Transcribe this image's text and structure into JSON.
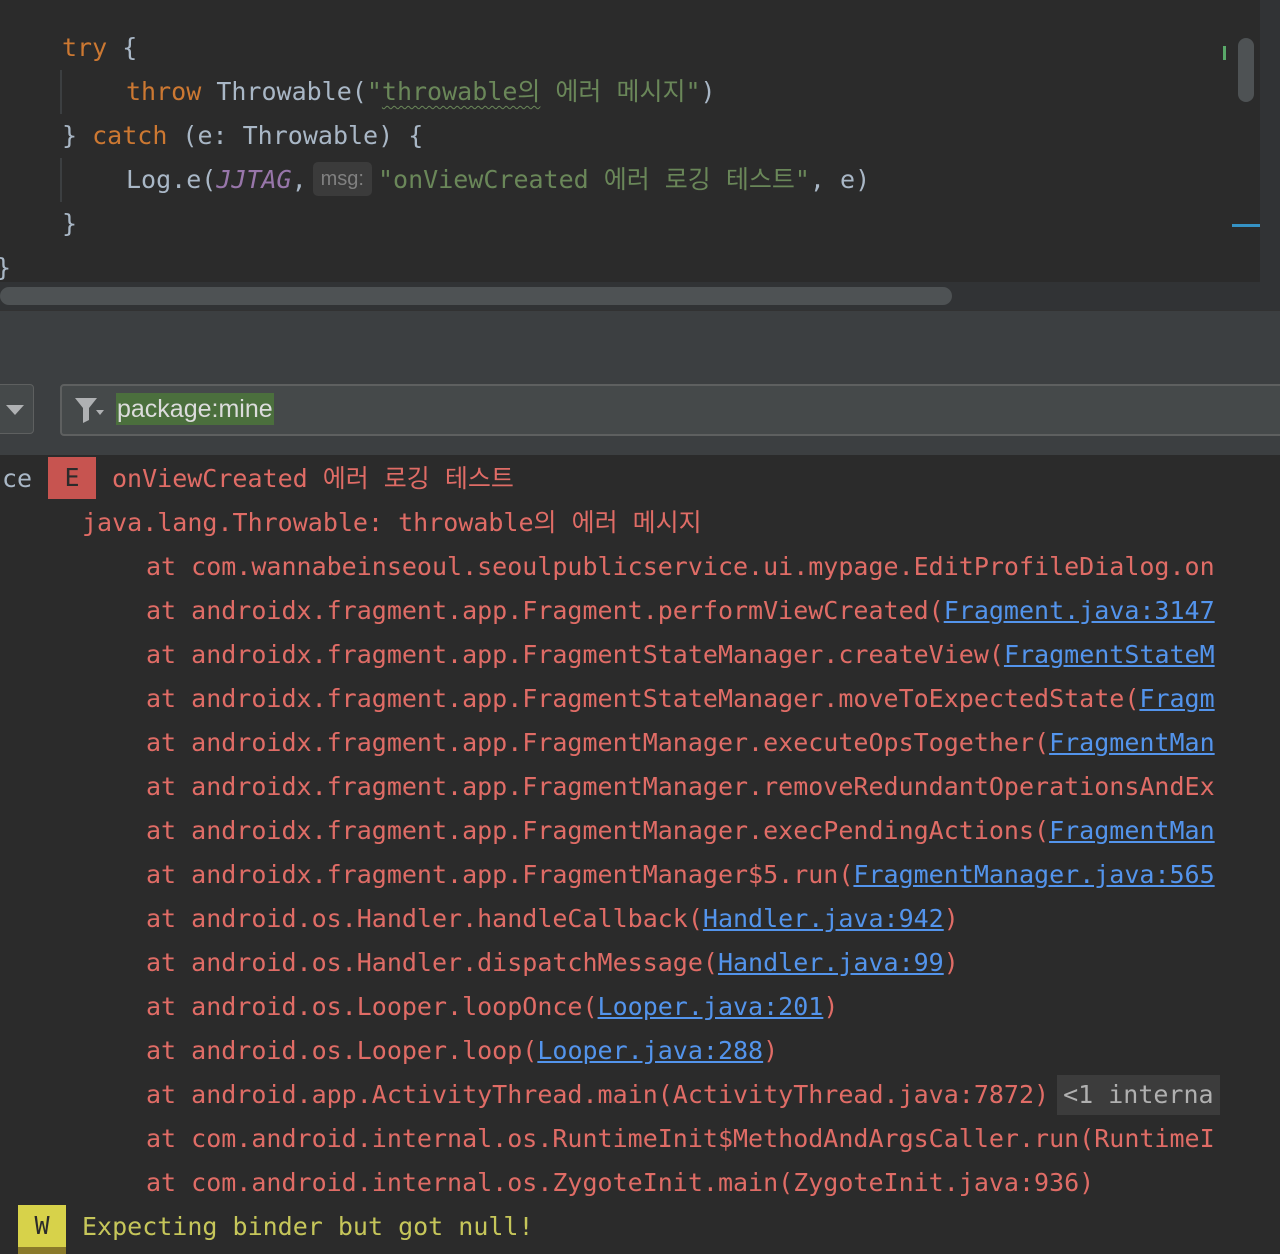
{
  "editor": {
    "lines": {
      "try_kw": "try",
      "try_brace": " {",
      "throw_kw": "throw",
      "throw_call": " Throwable(",
      "throw_quote_open": "\"",
      "throw_squiggly": "throwable의",
      "throw_msg_rest": " 에러 메시지\"",
      "throw_close": ")",
      "catch_open": "} ",
      "catch_kw": "catch",
      "catch_rest": " (e: Throwable) {",
      "log_call": "Log.e(",
      "log_tag": "JJTAG",
      "log_comma": ",",
      "param_hint": "msg:",
      "log_msg": "\"onViewCreated 에러 로깅 테스트\"",
      "log_rest": ", e)",
      "inner_close": "}",
      "outer_close": "}"
    }
  },
  "logcat": {
    "filter": {
      "query": "package:mine"
    },
    "entries": {
      "error": {
        "tag_fragment": "ce",
        "level": "E",
        "message": "onViewCreated 에러 로깅 테스트",
        "exception": "java.lang.Throwable: throwable의 에러 메시지",
        "stack": [
          {
            "text": "at com.wannabeinseoul.seoulpublicservice.ui.mypage.EditProfileDialog.on",
            "link": "",
            "tail": ""
          },
          {
            "text": "at androidx.fragment.app.Fragment.performViewCreated(",
            "link": "Fragment.java:3147",
            "tail": ""
          },
          {
            "text": "at androidx.fragment.app.FragmentStateManager.createView(",
            "link": "FragmentStateM",
            "tail": ""
          },
          {
            "text": "at androidx.fragment.app.FragmentStateManager.moveToExpectedState(",
            "link": "Fragm",
            "tail": ""
          },
          {
            "text": "at androidx.fragment.app.FragmentManager.executeOpsTogether(",
            "link": "FragmentMan",
            "tail": ""
          },
          {
            "text": "at androidx.fragment.app.FragmentManager.removeRedundantOperationsAndEx",
            "link": "",
            "tail": ""
          },
          {
            "text": "at androidx.fragment.app.FragmentManager.execPendingActions(",
            "link": "FragmentMan",
            "tail": ""
          },
          {
            "text": "at androidx.fragment.app.FragmentManager$5.run(",
            "link": "FragmentManager.java:565",
            "tail": ""
          },
          {
            "text": "at android.os.Handler.handleCallback(",
            "link": "Handler.java:942",
            "tail": ")"
          },
          {
            "text": "at android.os.Handler.dispatchMessage(",
            "link": "Handler.java:99",
            "tail": ")"
          },
          {
            "text": "at android.os.Looper.loopOnce(",
            "link": "Looper.java:201",
            "tail": ")"
          },
          {
            "text": "at android.os.Looper.loop(",
            "link": "Looper.java:288",
            "tail": ")"
          },
          {
            "text": "at android.app.ActivityThread.main(ActivityThread.java:7872)",
            "link": "",
            "tail": ""
          },
          {
            "text": "at com.android.internal.os.RuntimeInit$MethodAndArgsCaller.run(RuntimeI",
            "link": "",
            "tail": ""
          },
          {
            "text": "at com.android.internal.os.ZygoteInit.main(ZygoteInit.java:936)",
            "link": "",
            "tail": ""
          }
        ],
        "collapsed_frames": "<1 interna"
      },
      "warning": {
        "level": "W",
        "message": "Expecting binder but got null!"
      }
    }
  },
  "colors": {
    "background": "#2b2b2b",
    "keyword": "#cc7832",
    "string": "#6a8759",
    "error": "#e06c66",
    "link": "#5394ec",
    "warning": "#c6c65a"
  }
}
